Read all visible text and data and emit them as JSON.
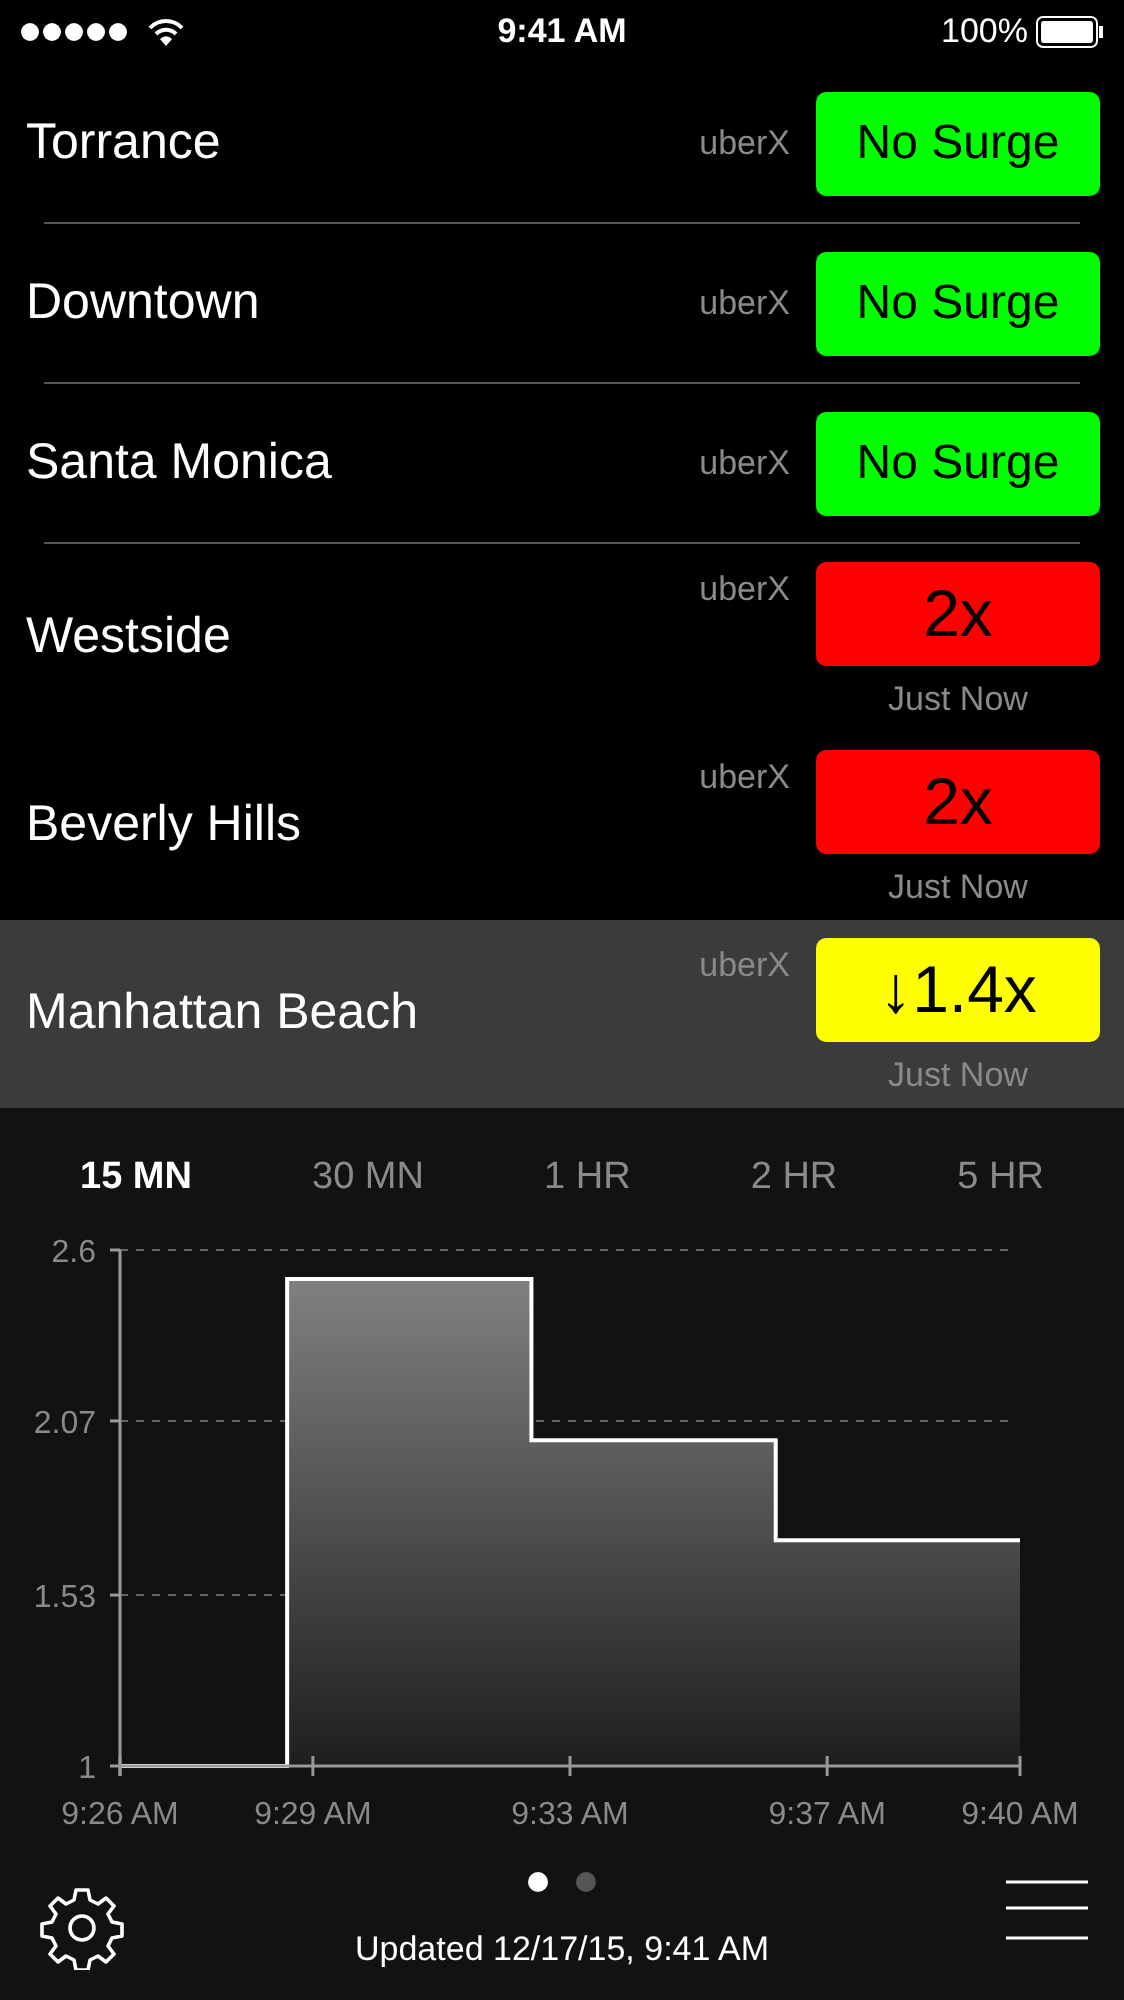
{
  "status_bar": {
    "time": "9:41 AM",
    "battery": "100%"
  },
  "rows": [
    {
      "name": "Torrance",
      "product": "uberX",
      "surge": "No Surge",
      "color": "#00ff00",
      "selected": false
    },
    {
      "name": "Downtown",
      "product": "uberX",
      "surge": "No Surge",
      "color": "#00ff00",
      "selected": false
    },
    {
      "name": "Santa Monica",
      "product": "uberX",
      "surge": "No Surge",
      "color": "#00ff00",
      "selected": false
    },
    {
      "name": "Westside",
      "product": "uberX",
      "surge": "2x",
      "color": "#ff0000",
      "updated": "Just Now",
      "selected": false
    },
    {
      "name": "Beverly Hills",
      "product": "uberX",
      "surge": "2x",
      "color": "#ff0000",
      "updated": "Just Now",
      "selected": false
    },
    {
      "name": "Manhattan Beach",
      "product": "uberX",
      "surge": "↓1.4x",
      "color": "#ffff00",
      "updated": "Just Now",
      "selected": true
    }
  ],
  "range_tabs": [
    {
      "label": "15 MN",
      "selected": true
    },
    {
      "label": "30 MN",
      "selected": false
    },
    {
      "label": "1 HR",
      "selected": false
    },
    {
      "label": "2 HR",
      "selected": false
    },
    {
      "label": "5 HR",
      "selected": false
    }
  ],
  "chart_data": {
    "type": "area",
    "x": [
      566,
      568.6,
      568.6,
      572.4,
      572.4,
      576.2,
      576.2,
      580
    ],
    "series": [
      {
        "color": "#ffffff",
        "values": [
          1,
          1,
          2.51,
          2.51,
          2.01,
          2.01,
          1.7,
          1.7
        ]
      }
    ],
    "xlim": [
      566,
      580
    ],
    "ylim": [
      1,
      2.6
    ],
    "xticks": [
      {
        "value": 566,
        "label": "9:26 AM"
      },
      {
        "value": 569,
        "label": "9:29 AM"
      },
      {
        "value": 573,
        "label": "9:33 AM"
      },
      {
        "value": 577,
        "label": "9:37 AM"
      },
      {
        "value": 580,
        "label": "9:40 AM"
      }
    ],
    "yticks": [
      {
        "value": 1,
        "label": "1"
      },
      {
        "value": 1.53,
        "label": "1.53"
      },
      {
        "value": 2.07,
        "label": "2.07"
      },
      {
        "value": 2.6,
        "label": "2.6"
      }
    ]
  },
  "pages": [
    {
      "selected": true
    },
    {
      "selected": false
    }
  ],
  "updated": "Updated 12/17/15, 9:41 AM"
}
